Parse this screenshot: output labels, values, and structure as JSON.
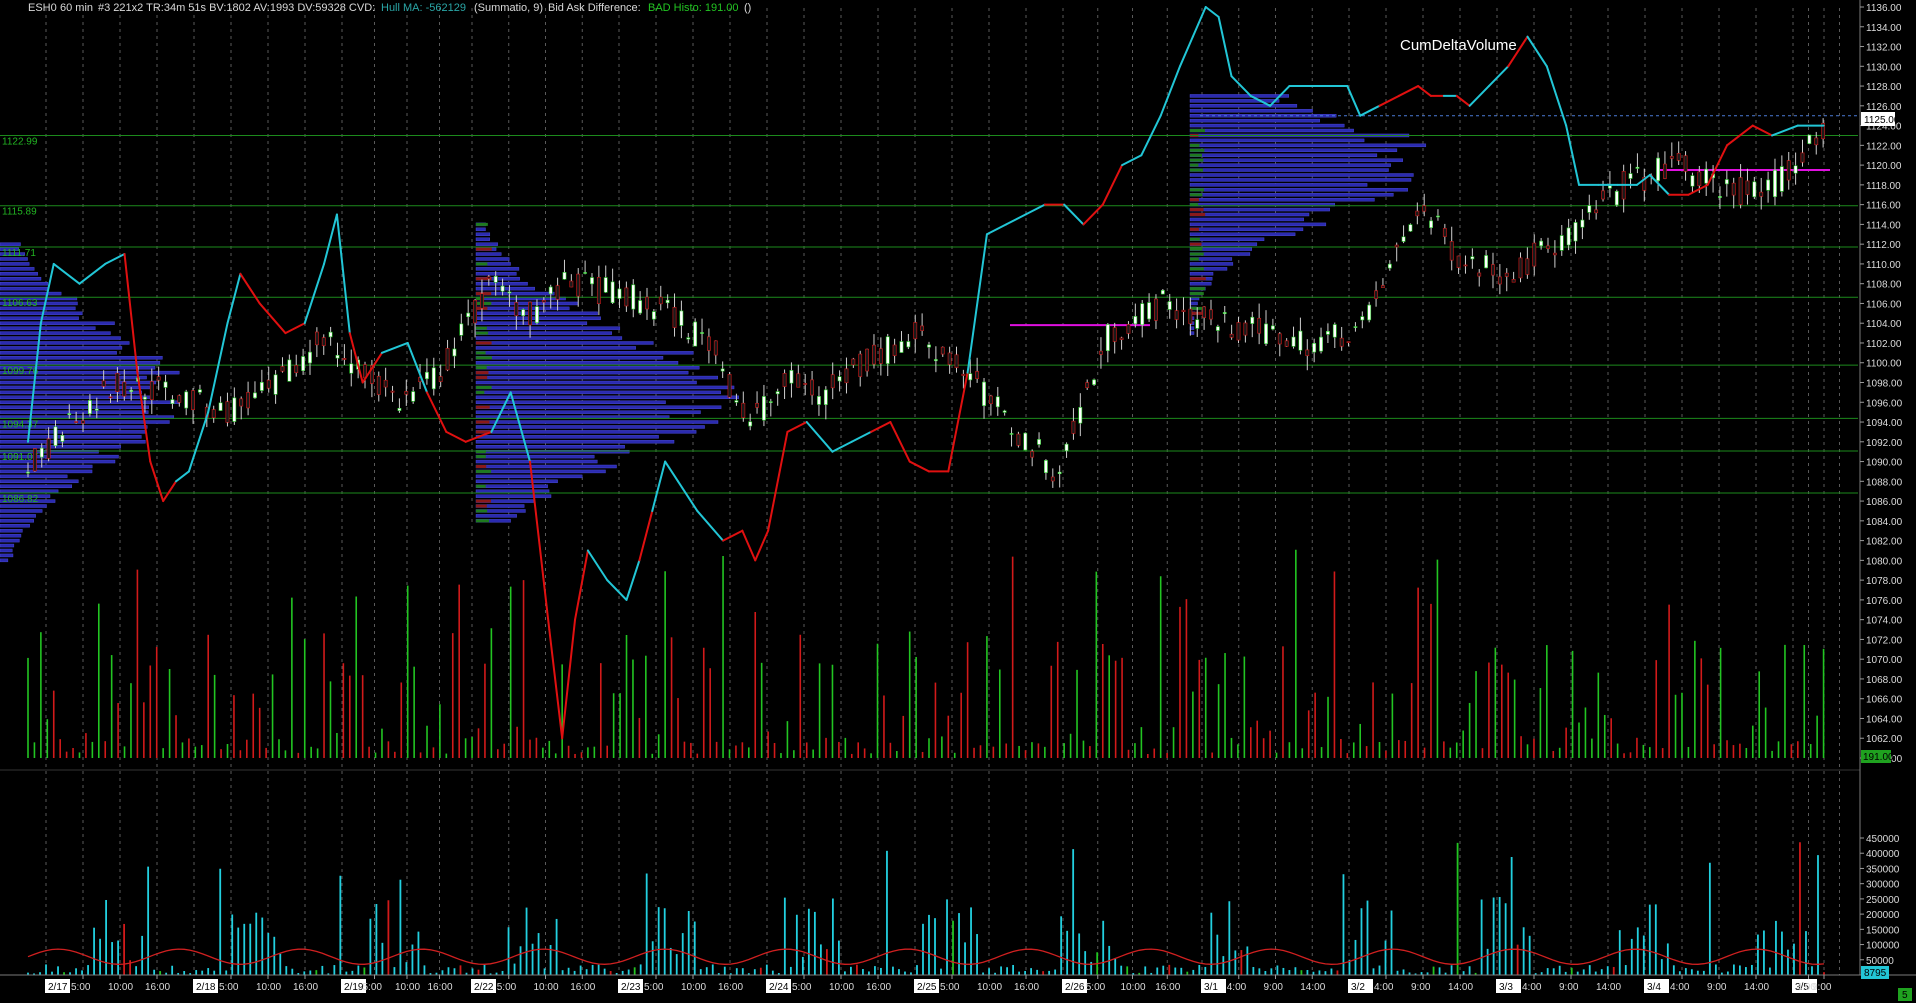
{
  "header": {
    "symbol": "ESH0",
    "interval": "60 min",
    "stats": "#3 221x2 TR:34m 51s BV:1802 AV:1993 DV:59328 CVD:",
    "hull_label": "Hull MA: -562129",
    "summatio": "(Summatio, 9)",
    "bad_label": "Bid Ask Difference:",
    "bad_value": "BAD Histo: 191.00",
    "paren": "()"
  },
  "colors": {
    "up": "#22c522",
    "down": "#d21a1a",
    "grid": "#5a5a5a",
    "level": "#1c8a1c",
    "profile": "#2b2bb0",
    "volume": "#22d0e0",
    "cvd_up": "#22c6d6",
    "cvd_down": "#e01010",
    "poc": "#e010e0"
  },
  "chart_data": {
    "type": "line",
    "title": "CumDeltaVolume",
    "price_axis": {
      "ylim": [
        1058,
        1138
      ],
      "ticks": [
        "1136.00",
        "1134.00",
        "1132.00",
        "1130.00",
        "1128.00",
        "1126.00",
        "1124.00",
        "1122.00",
        "1120.00",
        "1118.00",
        "1116.00",
        "1114.00",
        "1112.00",
        "1110.00",
        "1108.00",
        "1106.00",
        "1104.00",
        "1102.00",
        "1100.00",
        "1098.00",
        "1096.00",
        "1094.00",
        "1092.00",
        "1090.00",
        "1088.00",
        "1086.00",
        "1084.00",
        "1082.00",
        "1080.00",
        "1078.00",
        "1076.00",
        "1074.00",
        "1072.00",
        "1070.00",
        "1068.00",
        "1066.00",
        "1064.00",
        "1062.00",
        "1060.00"
      ],
      "last_price": "1125.00",
      "histo_value": "191.00"
    },
    "levels": [
      {
        "label": "1122.99",
        "price": 1122.99
      },
      {
        "label": "1115.89",
        "price": 1115.89
      },
      {
        "label": "1111.71",
        "price": 1111.71
      },
      {
        "label": "1106.63",
        "price": 1106.63
      },
      {
        "label": "1099.76",
        "price": 1099.76
      },
      {
        "label": "1094.37",
        "price": 1094.37
      },
      {
        "label": "1091.07",
        "price": 1091.07
      },
      {
        "label": "1086.82",
        "price": 1086.82
      }
    ],
    "volume_axis": {
      "ylim": [
        0,
        470000
      ],
      "ticks": [
        "450000",
        "400000",
        "350000",
        "300000",
        "250000",
        "200000",
        "150000",
        "100000",
        "50000"
      ],
      "last": "8795"
    },
    "x_labels": [
      "2/17",
      "5:00",
      "10:00",
      "16:00",
      "2/18",
      "5:00",
      "10:00",
      "16:00",
      "2/19",
      "5:00",
      "10:00",
      "16:00",
      "2/22",
      "5:00",
      "10:00",
      "16:00",
      "2/23",
      "5:00",
      "10:00",
      "16:00",
      "2/24",
      "5:00",
      "10:00",
      "16:00",
      "2/25",
      "5:00",
      "10:00",
      "16:00",
      "2/26",
      "5:00",
      "10:00",
      "16:00",
      "3/1",
      "4:00",
      "9:00",
      "14:00",
      "3/2",
      "4:00",
      "9:00",
      "14:00",
      "3/3",
      "4:00",
      "9:00",
      "14:00",
      "3/4",
      "4:00",
      "9:00",
      "14:00",
      "3/5",
      "4:00",
      "9:00"
    ],
    "day_dividers": [
      "2/17",
      "2/18",
      "2/19",
      "2/22",
      "2/23",
      "2/24",
      "2/25",
      "2/26",
      "3/1",
      "3/2",
      "3/3",
      "3/4",
      "3/5"
    ],
    "bottom_right": "5",
    "cvd": [
      [
        0,
        1092
      ],
      [
        2,
        1104
      ],
      [
        4,
        1110
      ],
      [
        8,
        1108
      ],
      [
        12,
        1110
      ],
      [
        15,
        1111
      ],
      [
        17,
        1099
      ],
      [
        19,
        1090
      ],
      [
        21,
        1086
      ],
      [
        23,
        1088
      ],
      [
        25,
        1089
      ],
      [
        28,
        1095
      ],
      [
        31,
        1104
      ],
      [
        33,
        1109
      ],
      [
        36,
        1106
      ],
      [
        40,
        1103
      ],
      [
        43,
        1104
      ],
      [
        46,
        1110
      ],
      [
        48,
        1115
      ],
      [
        50,
        1103
      ],
      [
        52,
        1098
      ],
      [
        55,
        1101
      ],
      [
        59,
        1102
      ],
      [
        62,
        1097
      ],
      [
        65,
        1093
      ],
      [
        68,
        1092
      ],
      [
        72,
        1093
      ],
      [
        75,
        1097
      ],
      [
        78,
        1090
      ],
      [
        81,
        1073
      ],
      [
        83,
        1062
      ],
      [
        85,
        1074
      ],
      [
        87,
        1081
      ],
      [
        90,
        1078
      ],
      [
        93,
        1076
      ],
      [
        95,
        1080
      ],
      [
        97,
        1085
      ],
      [
        99,
        1090
      ],
      [
        101,
        1088
      ],
      [
        104,
        1085
      ],
      [
        108,
        1082
      ],
      [
        111,
        1083
      ],
      [
        113,
        1080
      ],
      [
        115,
        1083
      ],
      [
        118,
        1093
      ],
      [
        121,
        1094
      ],
      [
        125,
        1091
      ],
      [
        128,
        1092
      ],
      [
        131,
        1093
      ],
      [
        134,
        1094
      ],
      [
        137,
        1090
      ],
      [
        140,
        1089
      ],
      [
        143,
        1089
      ],
      [
        146,
        1099
      ],
      [
        149,
        1113
      ],
      [
        152,
        1114
      ],
      [
        155,
        1115
      ],
      [
        158,
        1116
      ],
      [
        161,
        1116
      ],
      [
        164,
        1114
      ],
      [
        167,
        1116
      ],
      [
        170,
        1120
      ],
      [
        173,
        1121
      ],
      [
        176,
        1125
      ],
      [
        179,
        1130
      ],
      [
        181,
        1133
      ],
      [
        183,
        1136
      ],
      [
        185,
        1135
      ],
      [
        187,
        1129
      ],
      [
        190,
        1127
      ],
      [
        193,
        1126
      ],
      [
        196,
        1128
      ],
      [
        199,
        1128
      ],
      [
        202,
        1128
      ],
      [
        205,
        1128
      ],
      [
        207,
        1125
      ],
      [
        210,
        1126
      ],
      [
        213,
        1127
      ],
      [
        216,
        1128
      ],
      [
        218,
        1127
      ],
      [
        220,
        1127
      ],
      [
        222,
        1127
      ],
      [
        224,
        1126
      ],
      [
        227,
        1128
      ],
      [
        230,
        1130
      ],
      [
        233,
        1133
      ],
      [
        236,
        1130
      ],
      [
        239,
        1124
      ],
      [
        241,
        1118
      ],
      [
        244,
        1118
      ],
      [
        247,
        1118
      ],
      [
        250,
        1118
      ],
      [
        252,
        1119
      ],
      [
        255,
        1117
      ],
      [
        258,
        1117
      ],
      [
        261,
        1118
      ],
      [
        264,
        1122
      ],
      [
        268,
        1124
      ],
      [
        271,
        1123
      ],
      [
        275,
        1124
      ],
      [
        279,
        1124
      ]
    ],
    "cvd_dir": [
      1,
      1,
      1,
      1,
      1,
      -1,
      -1,
      -1,
      -1,
      1,
      1,
      1,
      1,
      -1,
      -1,
      -1,
      1,
      1,
      1,
      -1,
      -1,
      1,
      1,
      -1,
      -1,
      -1,
      1,
      1,
      -1,
      -1,
      -1,
      -1,
      1,
      1,
      1,
      -1,
      1,
      1,
      1,
      1,
      -1,
      -1,
      -1,
      -1,
      -1,
      1,
      1,
      1,
      -1,
      -1,
      -1,
      -1,
      -1,
      1,
      1,
      1,
      1,
      -1,
      1,
      -1,
      -1,
      1,
      1,
      1,
      1,
      1,
      1,
      1,
      1,
      1,
      1,
      1,
      1,
      1,
      1,
      1,
      -1,
      -1,
      -1,
      -1,
      1,
      -1,
      1,
      1,
      -1,
      1,
      1,
      1,
      1,
      1,
      1,
      1,
      1,
      -1,
      -1,
      -1,
      -1,
      -1,
      1,
      1,
      -1,
      1,
      1,
      -1,
      -1
    ]
  }
}
